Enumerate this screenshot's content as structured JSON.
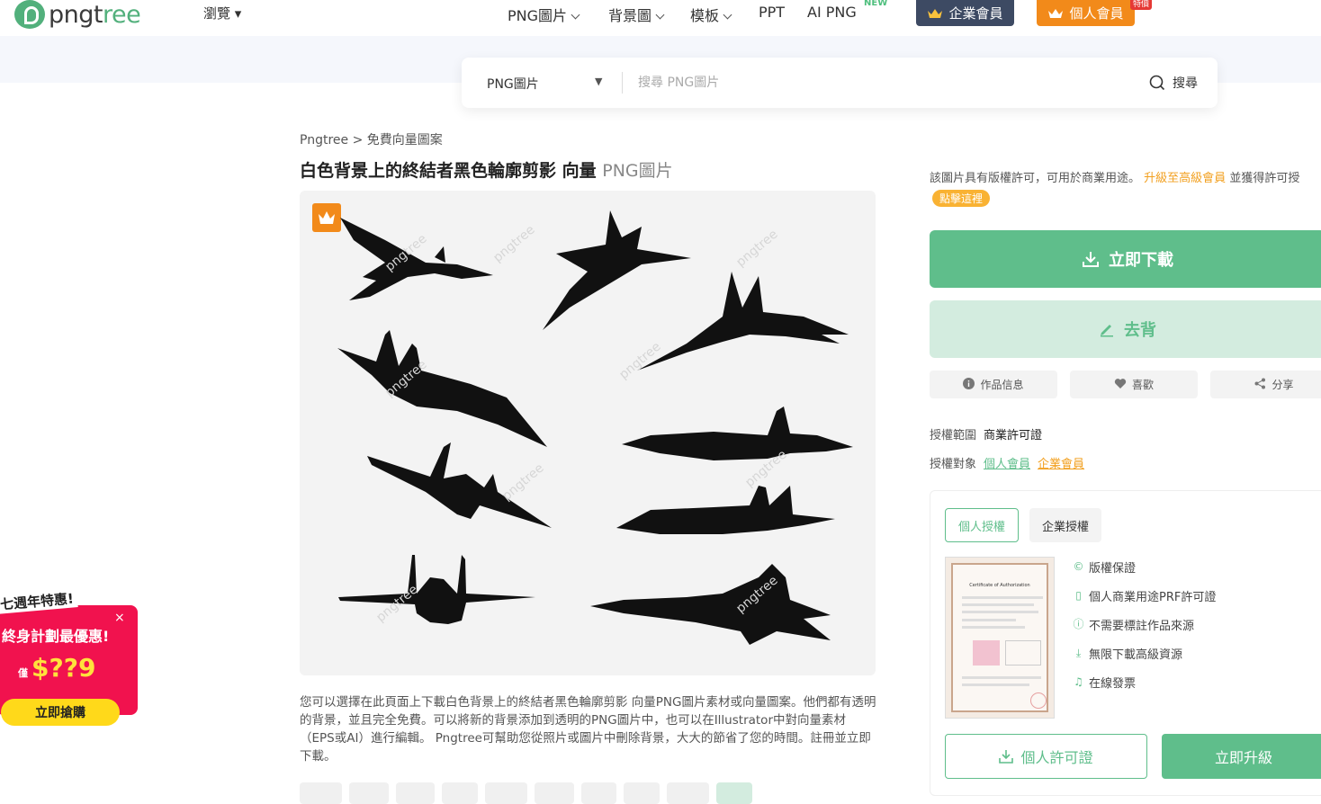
{
  "header": {
    "logo_text_a": "pngt",
    "logo_text_b": "ree",
    "browse_label": "瀏覽 ▾",
    "nav": [
      {
        "label": "PNG圖片"
      },
      {
        "label": "背景圖"
      },
      {
        "label": "模板"
      },
      {
        "label": "PPT"
      },
      {
        "label": "AI PNG"
      }
    ],
    "new_badge": "NEW",
    "enterprise_label": "企業會員",
    "personal_label": "個人會員",
    "hot_tag": "特價"
  },
  "search": {
    "type_label": "PNG圖片",
    "caret": "▼",
    "placeholder": "搜尋 PNG圖片",
    "button_label": "搜尋"
  },
  "breadcrumb": {
    "root": "Pngtree",
    "sep": " > ",
    "current": "免費向量圖案"
  },
  "title": {
    "main": "白色背景上的終結者黑色輪廓剪影 向量",
    "suffix": "PNG圖片"
  },
  "preview": {
    "watermark": "pngtree"
  },
  "description": "您可以選擇在此頁面上下載白色背景上的終結者黑色輪廓剪影 向量PNG圖片素材或向量圖案。他們都有透明的背景，並且完全免費。可以將新的背景添加到透明的PNG圖片中，也可以在Illustrator中對向量素材（EPS或AI）進行編輯。 Pngtree可幫助您從照片或圖片中刪除背景，大大的節省了您的時間。註冊並立即下載。",
  "sidebar": {
    "license_note_a": "該圖片具有版權許可，可用於商業用途。",
    "license_note_link": "升級至高級會員",
    "license_note_b": "並獲得許可授",
    "click_here": "點擊這裡",
    "download_label": "立即下載",
    "remove_bg_label": "去背",
    "info_label": "作品信息",
    "like_label": "喜歡",
    "share_label": "分享",
    "scope_label": "授權範圍",
    "scope_value": "商業許可證",
    "target_label": "授權對象",
    "target_personal": "個人會員",
    "target_enterprise": "企業會員",
    "tab_personal": "個人授權",
    "tab_enterprise": "企業授權",
    "cert_title": "Certificate of Authorization",
    "features": [
      "版權保證",
      "個人商業用途PRF許可證",
      "不需要標註作品來源",
      "無限下載高級資源",
      "在線發票"
    ],
    "license_btn": "個人許可證",
    "upgrade_btn": "立即升級"
  },
  "promo": {
    "ribbon": "七週年特惠!",
    "line1": "終身計劃最優惠!",
    "price_prefix": "僅",
    "price": "$??9",
    "close": "×",
    "button": "立即搶購"
  },
  "colors": {
    "green": "#5fbe8b",
    "orange": "#f28a1a",
    "navy": "#3d4a63",
    "promo_red": "#f1124e"
  }
}
